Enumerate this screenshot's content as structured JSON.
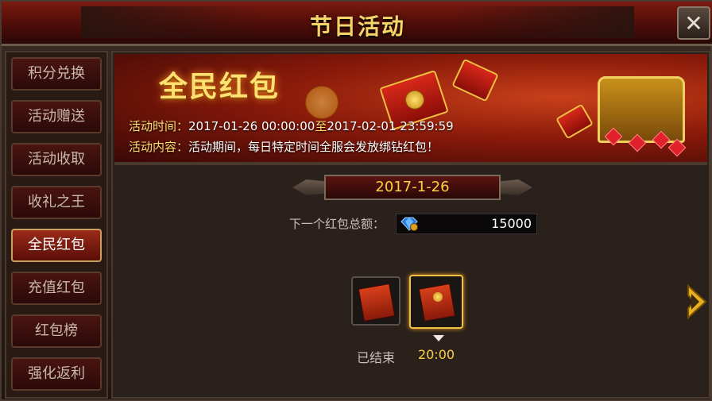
{
  "window": {
    "title": "节日活动",
    "close_icon": "close-icon"
  },
  "sidebar": {
    "tabs": [
      {
        "label": "积分兑换",
        "active": false
      },
      {
        "label": "活动赠送",
        "active": false
      },
      {
        "label": "活动收取",
        "active": false
      },
      {
        "label": "收礼之王",
        "active": false
      },
      {
        "label": "全民红包",
        "active": true
      },
      {
        "label": "充值红包",
        "active": false
      },
      {
        "label": "红包榜",
        "active": false
      },
      {
        "label": "强化返利",
        "active": false
      }
    ]
  },
  "banner": {
    "title": "全民红包",
    "time_label": "活动时间：",
    "time_start": "2017-01-26 00:00:00",
    "time_to": "至",
    "time_end": "2017-02-01 23:59:59",
    "content_label": "活动内容：",
    "content_text": "活动期间，每日特定时间全服会发放绑钻红包！"
  },
  "main": {
    "date": "2017-1-26",
    "next_total_label": "下一个红包总额：",
    "next_total_value": "15000",
    "currency_icon": "bound-diamond-icon",
    "slots": [
      {
        "label": "已结束",
        "state": "ended"
      },
      {
        "label": "20:00",
        "state": "selected"
      }
    ],
    "next_icon": "chevron-right-icon"
  },
  "colors": {
    "accent_gold": "#ffd040",
    "title_gold": "#f5d46a",
    "banner_red": "#8a1a0a"
  }
}
